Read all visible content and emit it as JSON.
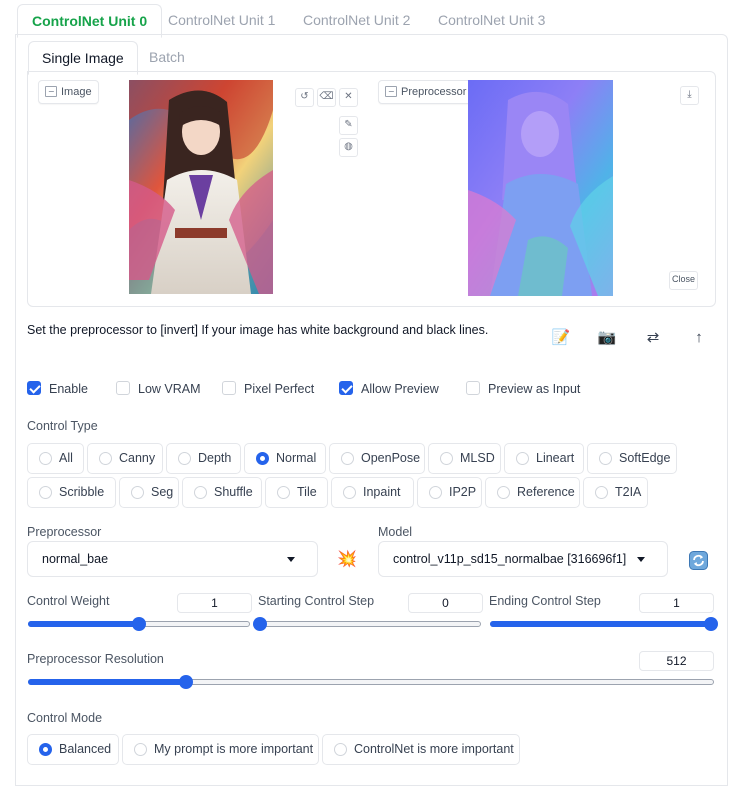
{
  "unit_tabs": [
    {
      "label": "ControlNet Unit 0",
      "active": true
    },
    {
      "label": "ControlNet Unit 1",
      "active": false
    },
    {
      "label": "ControlNet Unit 2",
      "active": false
    },
    {
      "label": "ControlNet Unit 3",
      "active": false
    }
  ],
  "inner_tabs": [
    {
      "label": "Single Image",
      "active": true
    },
    {
      "label": "Batch",
      "active": false
    }
  ],
  "image_panel": {
    "image_label": "Image",
    "preview_label": "Preprocessor Preview",
    "close_label": "Close",
    "tool_icons": [
      "undo-icon",
      "eraser-icon",
      "close-icon",
      "brush-icon",
      "palette-icon"
    ],
    "download_icon": "download-icon"
  },
  "hint_text": "Set the preprocessor to [invert] If your image has white background and black lines.",
  "action_icons": {
    "edit": "📝",
    "camera": "📷",
    "swap": "⇄",
    "upload": "↑"
  },
  "checkboxes": [
    {
      "label": "Enable",
      "checked": true
    },
    {
      "label": "Low VRAM",
      "checked": false
    },
    {
      "label": "Pixel Perfect",
      "checked": false
    },
    {
      "label": "Allow Preview",
      "checked": true
    },
    {
      "label": "Preview as Input",
      "checked": false
    }
  ],
  "control_type": {
    "label": "Control Type",
    "row1": [
      "All",
      "Canny",
      "Depth",
      "Normal",
      "OpenPose",
      "MLSD",
      "Lineart",
      "SoftEdge"
    ],
    "row2": [
      "Scribble",
      "Seg",
      "Shuffle",
      "Tile",
      "Inpaint",
      "IP2P",
      "Reference",
      "T2IA"
    ],
    "selected": "Normal"
  },
  "preprocessor": {
    "label": "Preprocessor",
    "value": "normal_bae",
    "run_icon": "💥"
  },
  "model": {
    "label": "Model",
    "value": "control_v11p_sd15_normalbae [316696f1]",
    "refresh_icon": "refresh-icon"
  },
  "sliders": {
    "control_weight": {
      "label": "Control Weight",
      "value": "1",
      "fraction": 0.5
    },
    "starting_step": {
      "label": "Starting Control Step",
      "value": "0",
      "fraction": 0.0
    },
    "ending_step": {
      "label": "Ending Control Step",
      "value": "1",
      "fraction": 1.0
    },
    "resolution": {
      "label": "Preprocessor Resolution",
      "value": "512",
      "fraction": 0.23
    }
  },
  "control_mode": {
    "label": "Control Mode",
    "options": [
      "Balanced",
      "My prompt is more important",
      "ControlNet is more important"
    ],
    "selected": "Balanced"
  },
  "colors": {
    "accent": "#2563eb",
    "active_tab": "#16a34a"
  }
}
